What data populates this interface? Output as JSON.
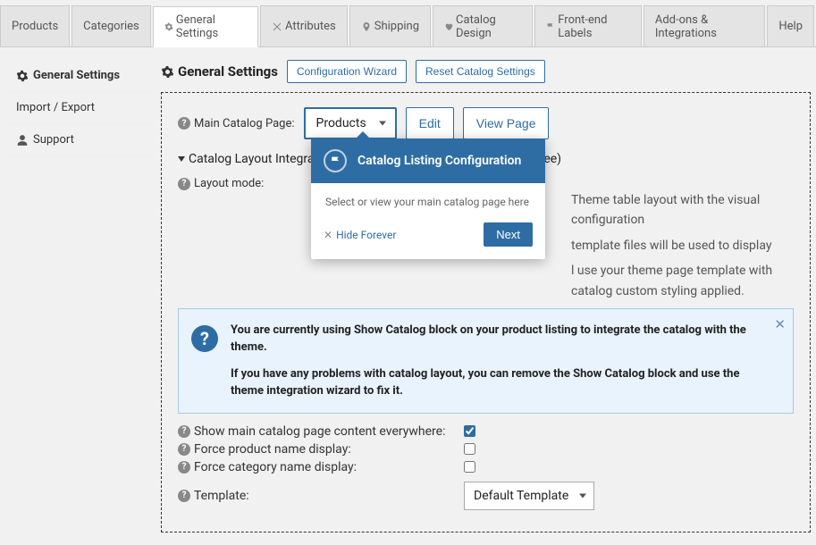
{
  "tabs": {
    "t0": "Products",
    "t1": "Categories",
    "t2": "General Settings",
    "t3": "Attributes",
    "t4": "Shipping",
    "t5": "Catalog Design",
    "t6": "Front-end Labels",
    "t7": "Add-ons & Integrations",
    "t8": "Help"
  },
  "sidebar": {
    "s0": "General Settings",
    "s1": "Import / Export",
    "s2": "Support"
  },
  "header": {
    "title": "General Settings",
    "btn_wizard": "Configuration Wizard",
    "btn_reset": "Reset Catalog Settings"
  },
  "main_page": {
    "label": "Main Catalog Page:",
    "select": "Products",
    "edit": "Edit",
    "view": "View Page"
  },
  "section": {
    "title": "Catalog Layout Integration Method (A Must To Select One of Three)"
  },
  "layout_mode": {
    "label": "Layout mode:",
    "opt1": "Theme table layout with the visual configuration",
    "opt2": "template files will be used to display",
    "opt3": "l use your theme page template with catalog custom styling applied."
  },
  "infobox": {
    "p1": "You are currently using Show Catalog block on your product listing to integrate the catalog with the theme.",
    "p2": "If you have any problems with catalog layout, you can remove the Show Catalog block and use the theme integration wizard to fix it."
  },
  "form": {
    "f1": "Show main catalog page content everywhere:",
    "f2": "Force product name display:",
    "f3": "Force category name display:",
    "f4": "Template:",
    "template_select": "Default Template"
  },
  "popover": {
    "title": "Catalog Listing Configuration",
    "body": "Select or view your main catalog page here",
    "hide": "Hide Forever",
    "next": "Next"
  }
}
